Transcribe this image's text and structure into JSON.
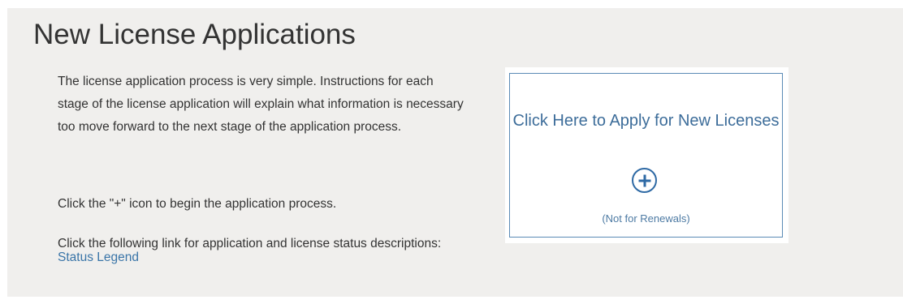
{
  "header": {
    "title": "New License Applications"
  },
  "intro": {
    "instructions": "The license application process is very simple. Instructions for each stage of the license application will explain what information is necessary too move forward to the next stage of the application process.",
    "click_hint": "Click the \"+\" icon to begin the application process.",
    "status_prefix": "Click the following link for application and license status descriptions: ",
    "status_link": "Status Legend"
  },
  "apply_card": {
    "title": "Click Here to Apply for New Licenses",
    "icon": "plus-circle-icon",
    "note": "(Not for Renewals)"
  },
  "colors": {
    "panel_background": "#f0efed",
    "link": "#3a75a8",
    "card_border": "#5b8bb6",
    "icon": "#2f6aa5"
  }
}
